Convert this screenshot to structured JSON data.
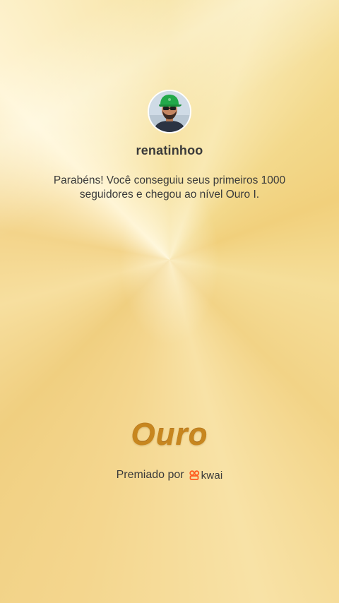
{
  "profile": {
    "username": "renatinhoo",
    "avatar_icon": "user-photo-avatar"
  },
  "message": "Parabéns! Você conseguiu seus primeiros 1000 seguidores e chegou ao nível Ouro I.",
  "level": {
    "title": "Ouro"
  },
  "award": {
    "label": "Premiado por",
    "brand_name": "kwai",
    "brand_icon": "kwai-logo-icon",
    "brand_color": "#ff5a1f"
  },
  "colors": {
    "background_gold": "#f6dc90",
    "level_text": "#a86b1a",
    "body_text": "#3a3a3a"
  }
}
